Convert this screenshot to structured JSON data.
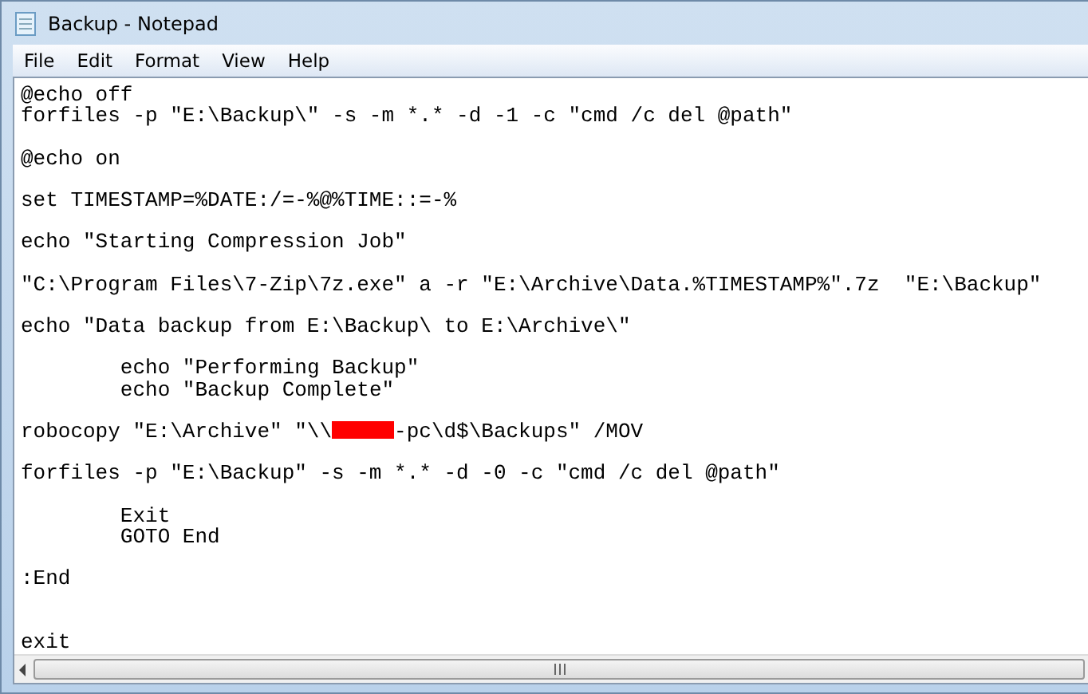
{
  "window": {
    "title": "Backup - Notepad"
  },
  "menu": [
    "File",
    "Edit",
    "Format",
    "View",
    "Help"
  ],
  "lines": [
    {
      "kind": "text",
      "text": "@echo off"
    },
    {
      "kind": "text",
      "text": "forfiles -p \"E:\\Backup\\\" -s -m *.* -d -1 -c \"cmd /c del @path\""
    },
    {
      "kind": "blank"
    },
    {
      "kind": "text",
      "text": "@echo on"
    },
    {
      "kind": "blank"
    },
    {
      "kind": "text",
      "text": "set TIMESTAMP=%DATE:/=-%@%TIME::=-%"
    },
    {
      "kind": "blank"
    },
    {
      "kind": "text",
      "text": "echo \"Starting Compression Job\""
    },
    {
      "kind": "blank"
    },
    {
      "kind": "text",
      "text": "\"C:\\Program Files\\7-Zip\\7z.exe\" a -r \"E:\\Archive\\Data.%TIMESTAMP%\".7z  \"E:\\Backup\""
    },
    {
      "kind": "blank"
    },
    {
      "kind": "text",
      "text": "echo \"Data backup from E:\\Backup\\ to E:\\Archive\\\""
    },
    {
      "kind": "blank"
    },
    {
      "kind": "text",
      "text": "\techo \"Performing Backup\""
    },
    {
      "kind": "text",
      "text": "\techo \"Backup Complete\""
    },
    {
      "kind": "blank"
    },
    {
      "kind": "redacted",
      "before": "robocopy \"E:\\Archive\" \"\\\\",
      "after": "-pc\\d$\\Backups\" /MOV"
    },
    {
      "kind": "blank"
    },
    {
      "kind": "text",
      "text": "forfiles -p \"E:\\Backup\" -s -m *.* -d -0 -c \"cmd /c del @path\""
    },
    {
      "kind": "blank"
    },
    {
      "kind": "text",
      "text": "\tExit"
    },
    {
      "kind": "text",
      "text": "\tGOTO End"
    },
    {
      "kind": "blank"
    },
    {
      "kind": "text",
      "text": ":End"
    },
    {
      "kind": "blank"
    },
    {
      "kind": "blank"
    },
    {
      "kind": "text",
      "text": "exit"
    }
  ]
}
